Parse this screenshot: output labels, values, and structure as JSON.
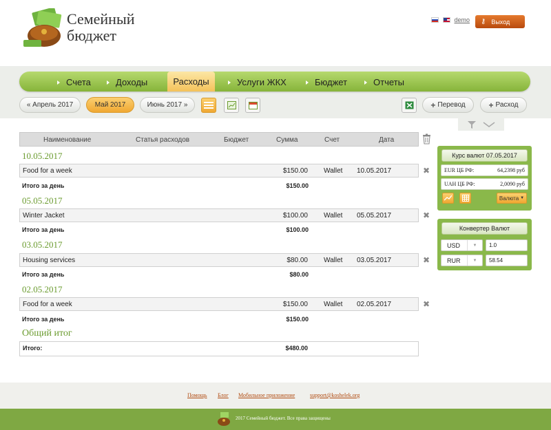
{
  "header": {
    "logo_line1": "Семейный",
    "logo_line2": "бюджет",
    "demo": "demo",
    "exit": "Выход"
  },
  "nav": {
    "items": [
      "Счета",
      "Доходы",
      "Расходы",
      "Услуги ЖКХ",
      "Бюджет",
      "Отчеты"
    ],
    "active": "Расходы"
  },
  "months": {
    "prev": "« Апрель 2017",
    "current": "Май 2017",
    "next": "Июнь 2017 »"
  },
  "actions": {
    "transfer": "Перевод",
    "expense": "Расход"
  },
  "table": {
    "headers": [
      "Наименование",
      "Статья расходов",
      "Бюджет",
      "Сумма",
      "Счет",
      "Дата"
    ],
    "groups": [
      {
        "date": "10.05.2017",
        "name": "Food for a week",
        "amount": "$150.00",
        "account": "Wallet",
        "row_date": "10.05.2017",
        "total_label": "Итого за день",
        "total": "$150.00"
      },
      {
        "date": "05.05.2017",
        "name": "Winter Jacket",
        "amount": "$100.00",
        "account": "Wallet",
        "row_date": "05.05.2017",
        "total_label": "Итого за день",
        "total": "$100.00"
      },
      {
        "date": "03.05.2017",
        "name": "Housing services",
        "amount": "$80.00",
        "account": "Wallet",
        "row_date": "03.05.2017",
        "total_label": "Итого за день",
        "total": "$80.00"
      },
      {
        "date": "02.05.2017",
        "name": "Food for a week",
        "amount": "$150.00",
        "account": "Wallet",
        "row_date": "02.05.2017",
        "total_label": "Итого за день",
        "total": "$150.00"
      }
    ],
    "grand_title": "Общий итог",
    "grand_label": "Итого:",
    "grand_total": "$480.00"
  },
  "rates": {
    "title": "Курс валют 07.05.2017",
    "eur_label": "EUR ЦБ РФ:",
    "eur_value": "64,2398 руб",
    "uah_label": "UAH ЦБ РФ:",
    "uah_value": "2,0090 руб",
    "currency_btn": "Валюта"
  },
  "converter": {
    "title": "Конвертер Валют",
    "from": "USD",
    "from_value": "1.0",
    "to": "RUR",
    "to_value": "58.54"
  },
  "footer": {
    "links": [
      "Помощь",
      "Блог",
      "Мобильное приложение",
      "support@koshelek.org"
    ],
    "copyright": "2017 Семейный бюджет. Все права защищены"
  },
  "colors": {
    "green": "#8ab84a",
    "orange": "#f0a832",
    "date_green": "#6a9b2e"
  }
}
